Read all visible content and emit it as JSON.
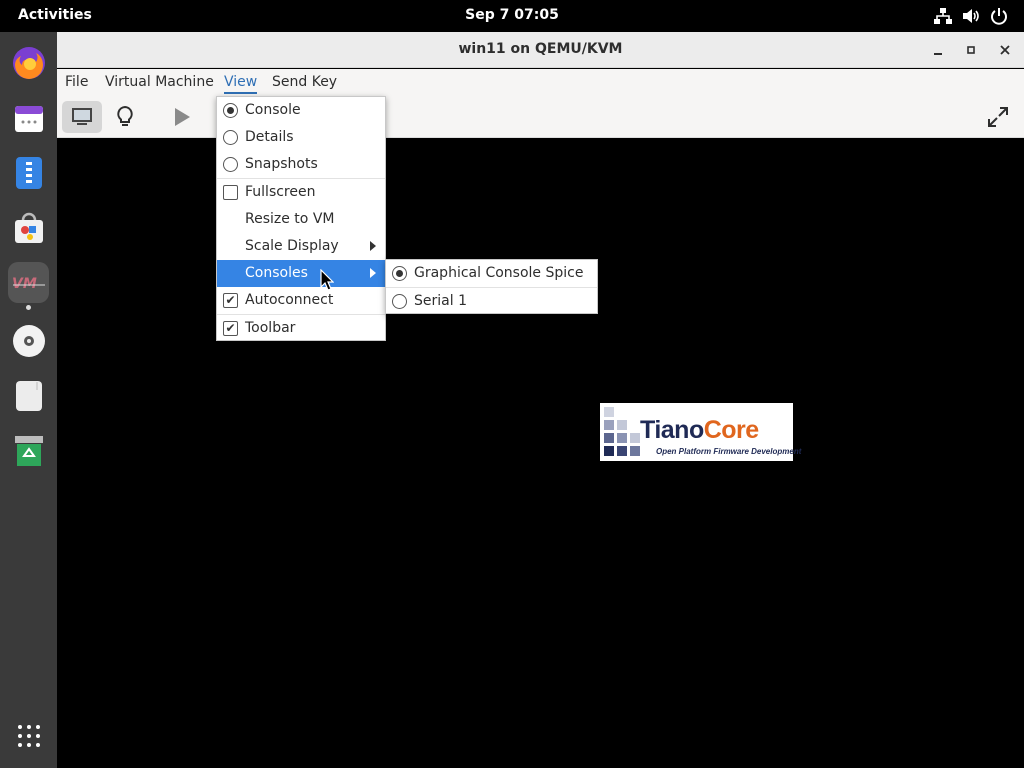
{
  "topbar": {
    "activities": "Activities",
    "clock": "Sep 7  07:05",
    "tray_icons": [
      "network-icon",
      "volume-icon",
      "power-icon"
    ]
  },
  "dock": {
    "items": [
      "firefox-icon",
      "calendar-icon",
      "notes-icon",
      "software-icon",
      "virt-manager-icon",
      "disc-icon",
      "text-editor-icon",
      "trash-icon",
      "app-grid-icon"
    ],
    "active": "virt-manager-icon"
  },
  "window": {
    "title": "win11 on QEMU/KVM",
    "menubar": [
      "File",
      "Virtual Machine",
      "View",
      "Send Key"
    ],
    "open_menu": "View"
  },
  "view_menu": {
    "items": [
      {
        "label": "Console",
        "kind": "radio",
        "checked": true
      },
      {
        "label": "Details",
        "kind": "radio",
        "checked": false
      },
      {
        "label": "Snapshots",
        "kind": "radio",
        "checked": false
      },
      {
        "label": "Fullscreen",
        "kind": "check",
        "checked": false
      },
      {
        "label": "Resize to VM",
        "kind": "plain"
      },
      {
        "label": "Scale Display",
        "kind": "submenu"
      },
      {
        "label": "Consoles",
        "kind": "submenu",
        "highlighted": true
      },
      {
        "label": "Autoconnect",
        "kind": "check",
        "checked": true
      },
      {
        "label": "Toolbar",
        "kind": "check",
        "checked": true
      }
    ]
  },
  "consoles_submenu": {
    "items": [
      {
        "label": "Graphical Console Spice",
        "checked": true
      },
      {
        "label": "Serial 1",
        "checked": false
      }
    ]
  },
  "logo": {
    "name_part1": "Tiano",
    "name_part2": "Core",
    "tagline": "Open Platform Firmware Development"
  },
  "colors": {
    "highlight": "#3584e4",
    "menu_open": "#2f6fb5",
    "tiano_orange": "#e0661e",
    "tiano_navy": "#1f2a55"
  }
}
